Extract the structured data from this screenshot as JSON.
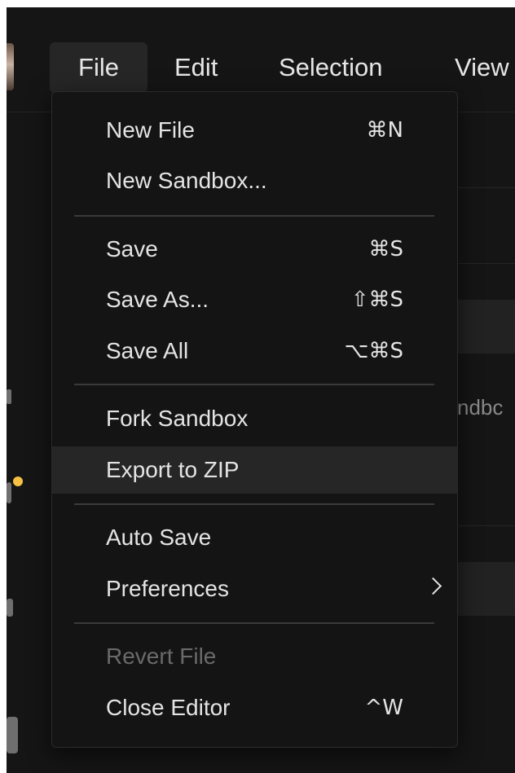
{
  "menubar": {
    "items": [
      {
        "label": "File"
      },
      {
        "label": "Edit"
      },
      {
        "label": "Selection"
      },
      {
        "label": "View"
      }
    ]
  },
  "background": {
    "partial_text": "ndbc"
  },
  "file_menu": {
    "items": [
      {
        "label": "New File",
        "shortcut": "⌘N"
      },
      {
        "label": "New Sandbox...",
        "shortcut": ""
      },
      {
        "label": "Save",
        "shortcut": "⌘S"
      },
      {
        "label": "Save As...",
        "shortcut": "⇧⌘S"
      },
      {
        "label": "Save All",
        "shortcut": "⌥⌘S"
      },
      {
        "label": "Fork Sandbox",
        "shortcut": ""
      },
      {
        "label": "Export to ZIP",
        "shortcut": "",
        "state": "highlighted"
      },
      {
        "label": "Auto Save",
        "shortcut": ""
      },
      {
        "label": "Preferences",
        "shortcut": "",
        "submenu": "chevron-right-icon"
      },
      {
        "label": "Revert File",
        "shortcut": "",
        "state": "disabled"
      },
      {
        "label": "Close Editor",
        "shortcut": "^W"
      }
    ]
  },
  "colors": {
    "background": "#151515",
    "menu_background": "#141414",
    "highlight": "#262626",
    "status_dot": "#f5c044",
    "disabled_text": "#6a6a6a"
  }
}
